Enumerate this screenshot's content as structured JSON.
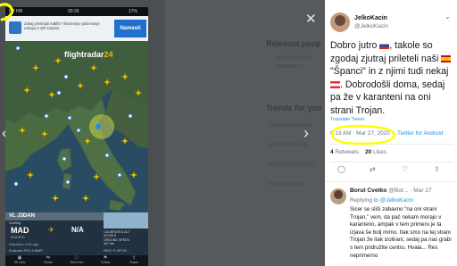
{
  "modal": {
    "close_icon": "close-icon",
    "prev_icon": "chevron-left-icon",
    "next_icon": "chevron-right-icon"
  },
  "phone": {
    "status": {
      "carrier": "HT HR",
      "time": "00:26",
      "battery": "17%"
    },
    "ad": {
      "text": "Zakaj prekinjali mBills? Skeniranje plačevanje nakupa s QR kodami.",
      "button": "Namesti"
    },
    "map": {
      "logo_a": "flightradar",
      "logo_b": "24"
    },
    "flight": {
      "callsign": "VL J3DAN",
      "airline": "Vueling",
      "from": "MAD",
      "from_city": "MADRID",
      "to": "N/A",
      "departed": "Departed 2:00 ago",
      "stats": [
        "CALIBRATED ALT",
        "33,000 ft",
        "GROUND SPEED",
        "407 kts"
      ],
      "aircraft": "Embraer ERJ-145MP",
      "reg": "REG: F-HFCN"
    },
    "tabs": [
      {
        "icon": "3d-icon",
        "glyph": "▣",
        "label": "3D view"
      },
      {
        "icon": "route-icon",
        "glyph": "⇆",
        "label": "Route"
      },
      {
        "icon": "more-info-icon",
        "glyph": "ⓘ",
        "label": "More info"
      },
      {
        "icon": "follow-icon",
        "glyph": "⚑",
        "label": "Follow"
      },
      {
        "icon": "share-icon",
        "glyph": "⇪",
        "label": "Share"
      }
    ]
  },
  "tweet": {
    "name": "JelkoKacin",
    "handle": "@JelkoKacin",
    "text_1": "Dobro jutro ",
    "text_2": ", takole so zgodaj zjutraj prileteli naši ",
    "text_3": " \"Španci\" in z njimi tudi nekaj ",
    "text_4": ". Dobrodošli doma, sedaj pa že v karanteni  na oni strani Trojan.",
    "flags": [
      "flag-slovenia-icon",
      "flag-spain-icon",
      "flag-austria-icon"
    ],
    "translate": "Translate Tweet",
    "timestamp": "6:13 AM · Mar 27, 2020 ·",
    "source": "Twitter for Android",
    "retweets": "4",
    "retweets_label": "Retweets",
    "likes": "20",
    "likes_label": "Likes"
  },
  "reply": {
    "name": "Borut Cvetko",
    "handle_date": "@Bor... · Mar 27",
    "replying_label": "Replying to",
    "replying_to": "@JelkoKacin",
    "text": "Sicer se sliši zabavno \"na oni strani Trojan,\" vem, da pač nekam morajo v karanteno, ampak v tem primeru je ta izjava še bolj mimo. Itak smo na tej strani Trojan že itak izolirani, sedaj pa nas grabi s tem pridružite centru. Hvala... Res neprimerno"
  },
  "highlight_color": "#ffff00"
}
